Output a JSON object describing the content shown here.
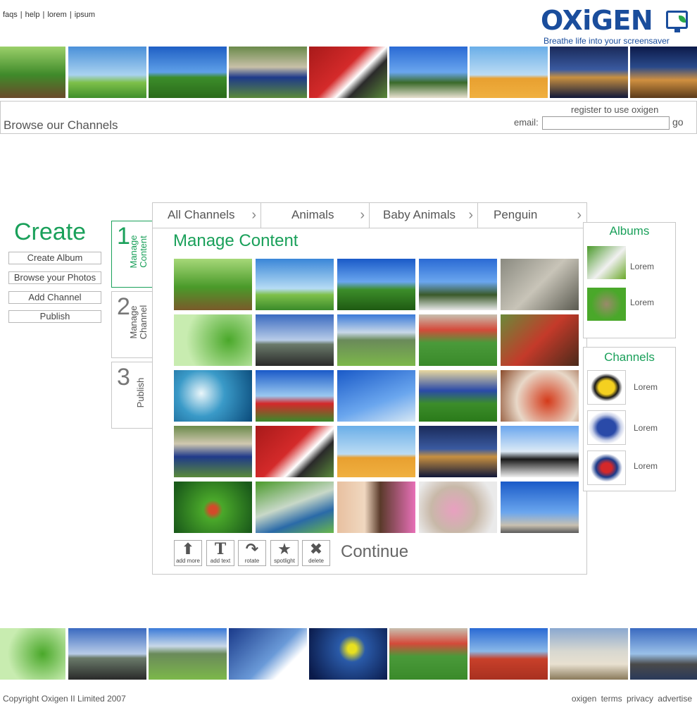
{
  "top_links": [
    "faqs",
    "help",
    "lorem",
    "ipsum"
  ],
  "logo": {
    "word": "OXiGEN",
    "tagline": "Breathe life into your screensaver"
  },
  "colors": {
    "brand_blue": "#1a4d9c",
    "accent_green": "#1aa05a",
    "border_grey": "#c8c8c8"
  },
  "top_strip": [
    "forest path",
    "green meadow and sky",
    "daffodil",
    "football legs",
    "football player 9",
    "celebrating fans",
    "camel desert",
    "tower bridge",
    "colosseum"
  ],
  "browse": {
    "title": "Browse our Channels",
    "register_text": "register to use oxigen",
    "email_label": "email:",
    "email_value": "",
    "go_label": "go"
  },
  "create": {
    "title": "Create",
    "buttons": [
      "Create Album",
      "Browse your Photos",
      "Add Channel",
      "Publish"
    ]
  },
  "steps": [
    {
      "number": "1",
      "label": "Manage Content",
      "active": true
    },
    {
      "number": "2",
      "label": "Manage Channel",
      "active": false
    },
    {
      "number": "3",
      "label": "Publish",
      "active": false
    }
  ],
  "breadcrumbs": [
    "All Channels",
    "Animals",
    "Baby Animals",
    "Penguin"
  ],
  "panel_title": "Manage Content",
  "photo_grid": [
    [
      "forest path",
      "green meadow",
      "daffodil",
      "fans cheering",
      "koalas"
    ],
    [
      "green leaves",
      "open road",
      "mountain valley",
      "football match",
      "smiling girl"
    ],
    [
      "ocean wave",
      "poppy field",
      "dandelion",
      "footballers",
      "tomato soup"
    ],
    [
      "football legs",
      "football player 9",
      "camel desert",
      "tower bridge",
      "penguins"
    ],
    [
      "tree frog",
      "kids on grass",
      "two girls",
      "dog with goggles",
      "father and son"
    ]
  ],
  "tools": [
    {
      "icon": "add-more-icon",
      "glyph": "⬆",
      "label": "add more"
    },
    {
      "icon": "add-text-icon",
      "glyph": "T",
      "label": "add text"
    },
    {
      "icon": "rotate-icon",
      "glyph": "↷",
      "label": "rotate"
    },
    {
      "icon": "spotlight-icon",
      "glyph": "★",
      "label": "spotlight"
    },
    {
      "icon": "delete-icon",
      "glyph": "✖",
      "label": "delete"
    }
  ],
  "continue_label": "Continue",
  "albums": {
    "title": "Albums",
    "items": [
      {
        "thumb": "woman on bed",
        "label": "Lorem"
      },
      {
        "thumb": "kitten",
        "label": "Lorem"
      }
    ]
  },
  "channels": {
    "title": "Channels",
    "items": [
      {
        "thumb": "wasps logo",
        "label": "Lorem"
      },
      {
        "thumb": "rhinos logo",
        "label": "Lorem"
      },
      {
        "thumb": "nfl logo",
        "label": "Lorem"
      }
    ]
  },
  "bottom_strip": [
    "green leaves",
    "open road",
    "mountain valley",
    "football goal net",
    "goalkeeper dive",
    "football match",
    "red square",
    "taj mahal",
    "brooklyn bridge"
  ],
  "footer": {
    "copyright": "Copyright Oxigen II Limited 2007",
    "links": [
      "oxigen",
      "terms",
      "privacy",
      "advertise"
    ]
  }
}
